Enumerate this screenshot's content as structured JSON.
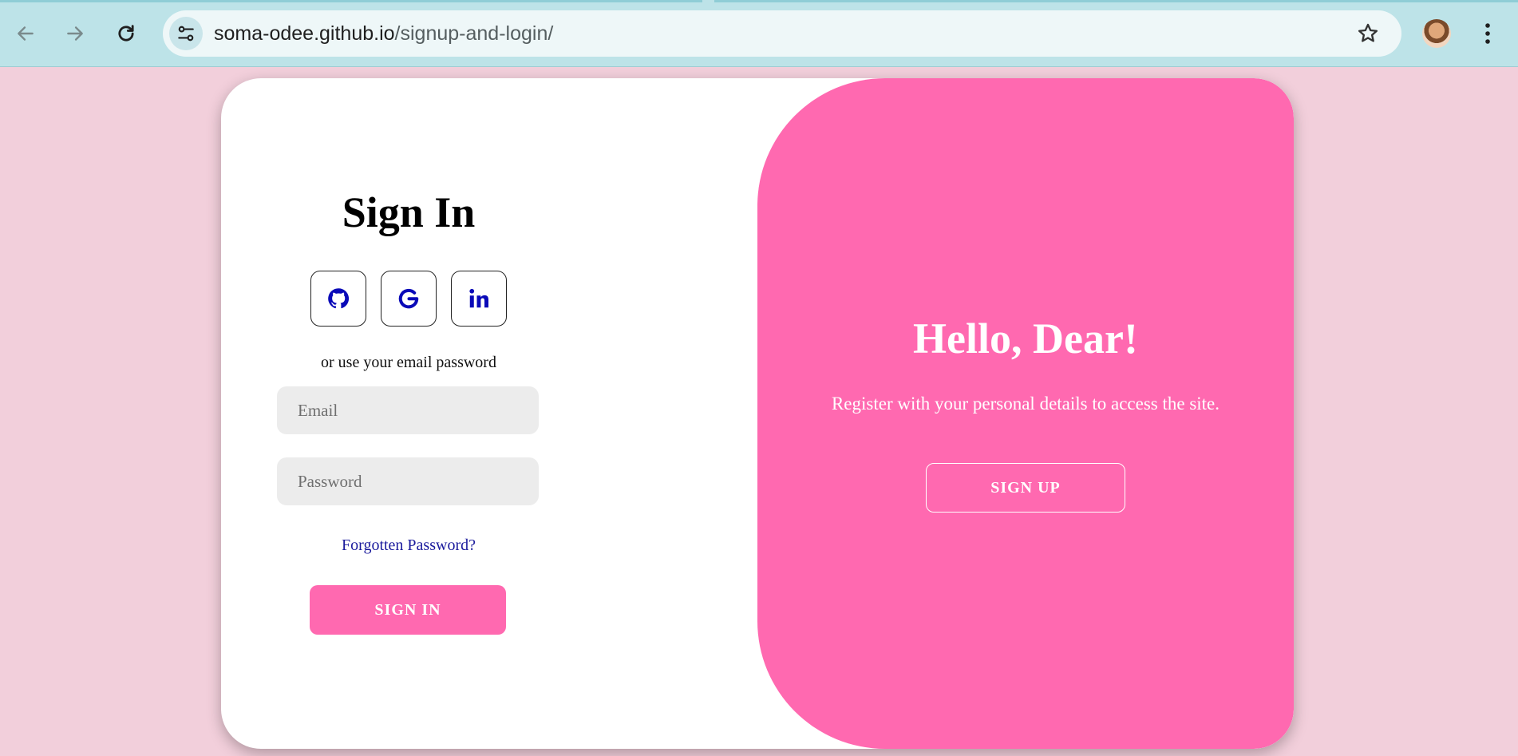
{
  "browser": {
    "url_domain": "soma-odee.github.io",
    "url_path": "/signup-and-login/",
    "icons": {
      "back": "arrow-left-icon",
      "forward": "arrow-right-icon",
      "reload": "reload-icon",
      "site_info": "tune-icon",
      "bookmark": "star-icon",
      "profile": "avatar",
      "menu": "kebab-menu-icon"
    }
  },
  "signin": {
    "title": "Sign In",
    "social": [
      {
        "name": "github",
        "icon": "github-icon"
      },
      {
        "name": "google",
        "icon": "google-icon"
      },
      {
        "name": "linkedin",
        "icon": "linkedin-icon"
      }
    ],
    "or_text": "or use your email password",
    "email_placeholder": "Email",
    "password_placeholder": "Password",
    "forgot_label": "Forgotten Password?",
    "button_label": "SIGN IN"
  },
  "hello": {
    "title": "Hello, Dear!",
    "text": "Register with your personal details to access the site.",
    "button_label": "SIGN UP"
  },
  "colors": {
    "page_bg": "#f2cfdb",
    "accent_pink": "#ff69b0",
    "chrome_bg": "#bde3e8",
    "icon_blue": "#0a0ab8",
    "link_blue": "#1a1a9c"
  }
}
